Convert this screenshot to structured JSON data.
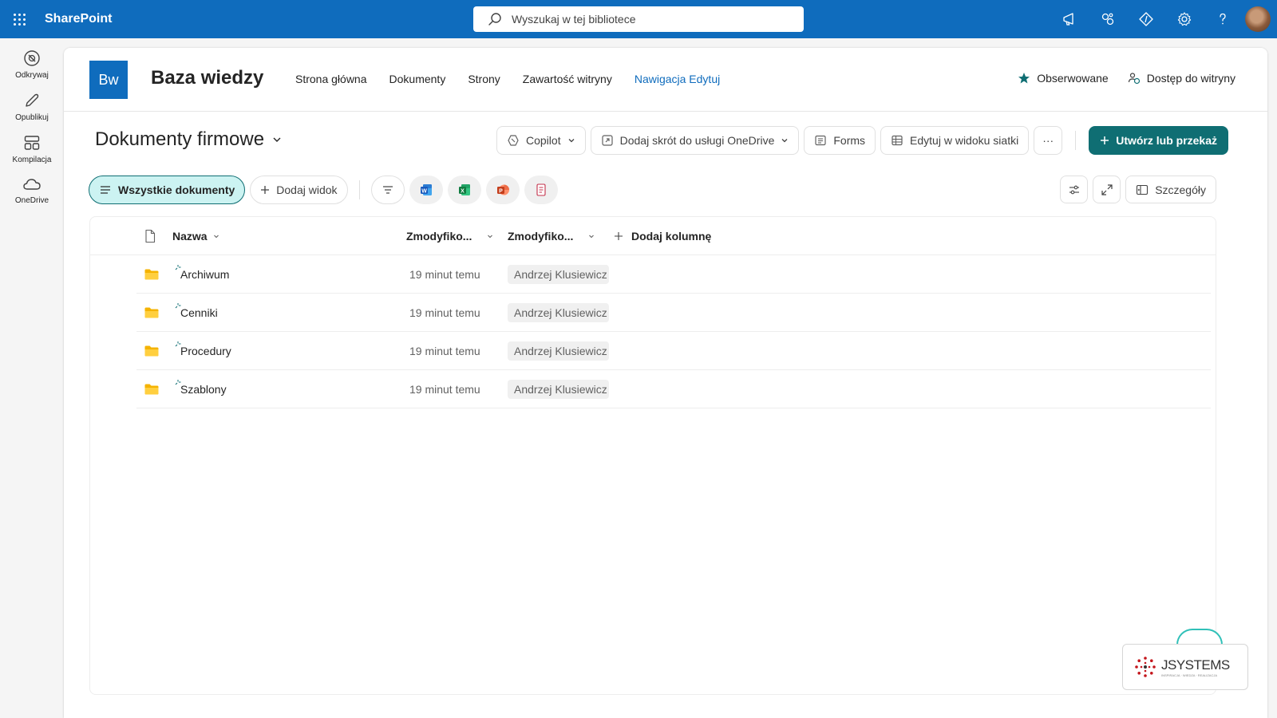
{
  "suitebar": {
    "brand": "SharePoint",
    "search_placeholder": "Wyszukaj w tej bibliotece",
    "icons": [
      "megaphone-icon",
      "share-network-icon",
      "diamond-code-icon",
      "gear-icon",
      "help-icon"
    ]
  },
  "appbar": {
    "items": [
      {
        "label": "Odkrywaj",
        "icon": "compass-icon"
      },
      {
        "label": "Opublikuj",
        "icon": "pen-icon"
      },
      {
        "label": "Kompilacja",
        "icon": "layout-icon"
      },
      {
        "label": "OneDrive",
        "icon": "cloud-icon"
      }
    ]
  },
  "site": {
    "logo": "Bw",
    "title": "Baza wiedzy",
    "nav": [
      "Strona główna",
      "Dokumenty",
      "Strony",
      "Zawartość witryny"
    ],
    "nav_edit": "Nawigacja Edytuj",
    "follow": "Obserwowane",
    "access": "Dostęp do witryny"
  },
  "library": {
    "title": "Dokumenty firmowe",
    "commands": {
      "copilot": "Copilot",
      "onedrive": "Dodaj skrót do usługi OneDrive",
      "forms": "Forms",
      "grid": "Edytuj w widoku siatki",
      "more": "···",
      "create": "Utwórz lub przekaż"
    },
    "views": {
      "all": "Wszystkie dokumenty",
      "add": "Dodaj widok",
      "details": "Szczegóły"
    }
  },
  "table": {
    "headers": {
      "name": "Nazwa",
      "modified": "Zmodyfiko...",
      "modified_by": "Zmodyfiko...",
      "add_column": "Dodaj kolumnę"
    },
    "rows": [
      {
        "name": "Archiwum",
        "modified": "19 minut temu",
        "by": "Andrzej Klusiewicz"
      },
      {
        "name": "Cenniki",
        "modified": "19 minut temu",
        "by": "Andrzej Klusiewicz"
      },
      {
        "name": "Procedury",
        "modified": "19 minut temu",
        "by": "Andrzej Klusiewicz"
      },
      {
        "name": "Szablony",
        "modified": "19 minut temu",
        "by": "Andrzej Klusiewicz"
      }
    ]
  },
  "watermark": {
    "text": "JSYSTEMS",
    "sub": "INSPIRACJA · WIEDZA · REALIZACJA"
  },
  "colors": {
    "suite": "#0f6cbd",
    "primary": "#0f6e73",
    "active_view": "#ccf3f2"
  }
}
